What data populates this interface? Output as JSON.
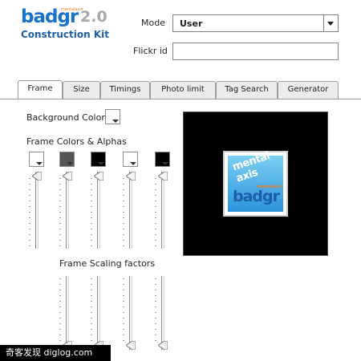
{
  "logo": {
    "word": "badgr",
    "version": "2.0",
    "tiny": "mentalaxis",
    "subtitle": "Construction Kit"
  },
  "form": {
    "mode_label": "Mode",
    "mode_value": "User",
    "flickr_label": "Flickr id",
    "flickr_value": ""
  },
  "tabs": [
    "Frame",
    "Size",
    "Timings",
    "Photo limit",
    "Tag Search",
    "Generator"
  ],
  "active_tab": "Frame",
  "frame": {
    "background_color_label": "Background Color",
    "background_color": "#ffffff",
    "frame_colors_label": "Frame Colors & Alphas",
    "frame_colors": [
      "#ffffff",
      "#555555",
      "#000000",
      "#ffffff",
      "#000000"
    ],
    "alpha_levels": [
      1.0,
      1.0,
      1.0,
      1.0,
      1.0
    ],
    "scaling_label": "Frame Scaling factors",
    "scaling_levels": [
      0.0,
      0.0,
      0.0,
      0.0
    ]
  },
  "preview": {
    "badge_text_1": "mental axis",
    "badge_text_2": "badgr",
    "badge_tiny": "mentalaxis"
  },
  "footer": {
    "text": "奇客发现 diglog.com"
  }
}
